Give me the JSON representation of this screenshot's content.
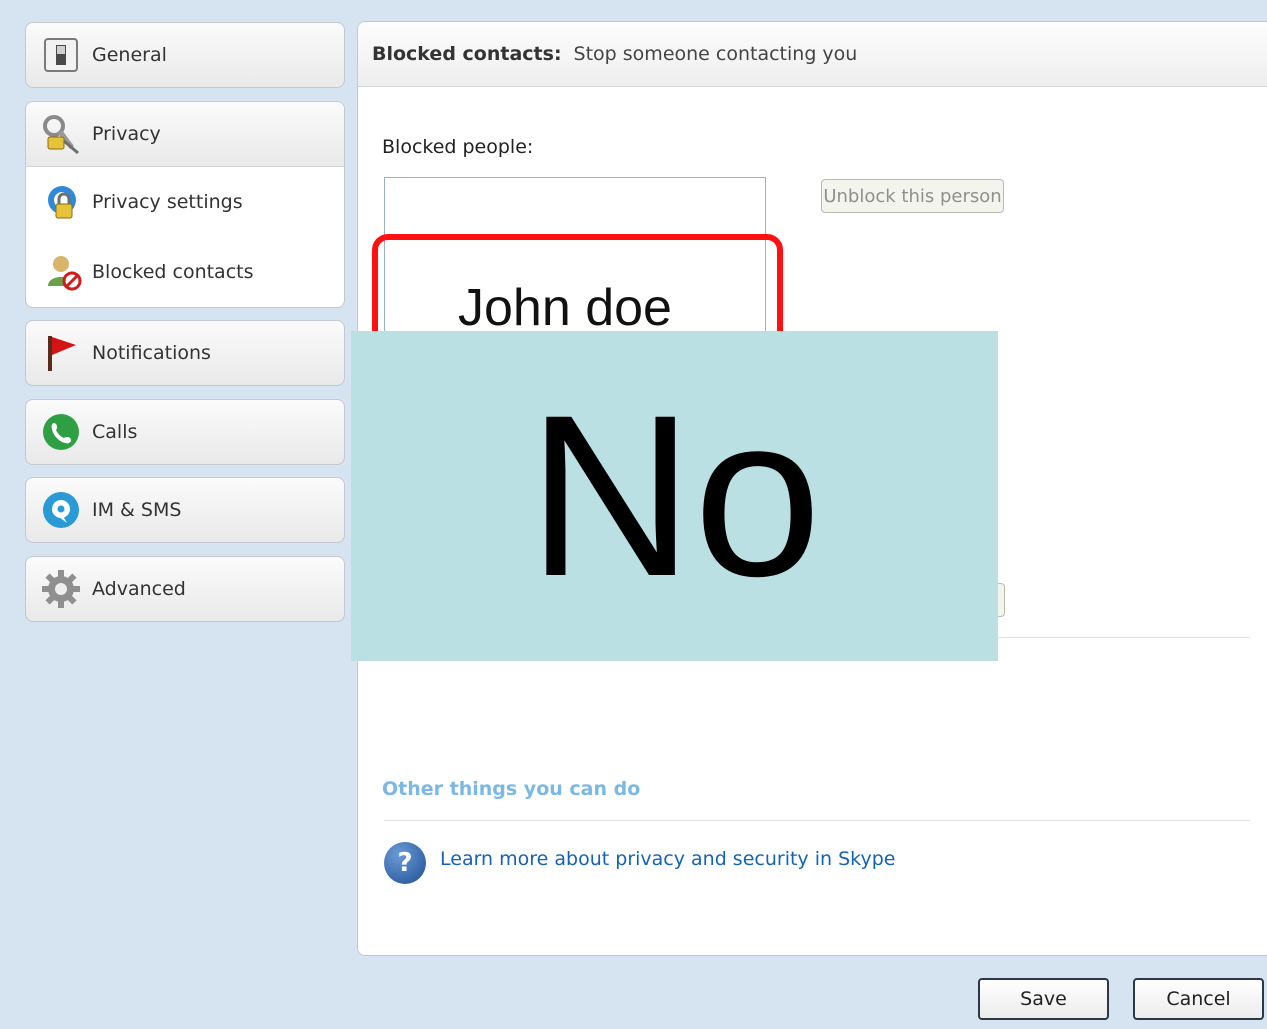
{
  "sidebar": {
    "general": "General",
    "privacy": "Privacy",
    "privacy_settings": "Privacy settings",
    "blocked_contacts": "Blocked contacts",
    "notifications": "Notifications",
    "calls": "Calls",
    "im_sms": "IM & SMS",
    "advanced": "Advanced"
  },
  "panel": {
    "title_bold": "Blocked contacts:",
    "title_rest": "Stop someone contacting you",
    "blocked_label": "Blocked people:",
    "unblock_button": "Unblock this person",
    "other_title": "Other things you can do",
    "help_link": "Learn more about privacy and security in Skype"
  },
  "annotation": {
    "highlight_text": "John doe",
    "overlay_text": "No"
  },
  "footer": {
    "save": "Save",
    "cancel": "Cancel"
  },
  "colors": {
    "background": "#d6e4f2",
    "highlight_border": "#ff1111",
    "overlay": "#bbe0e3",
    "link": "#1463b4",
    "section_title": "#7cb8e4"
  },
  "icons": {
    "general": "switch-icon",
    "privacy": "keys-icon",
    "privacy_settings": "privacy-lock-icon",
    "blocked_contacts": "blocked-user-icon",
    "notifications": "red-flag-icon",
    "calls": "phone-icon",
    "im_sms": "chat-bubble-icon",
    "advanced": "gear-icon",
    "help": "question-icon"
  }
}
